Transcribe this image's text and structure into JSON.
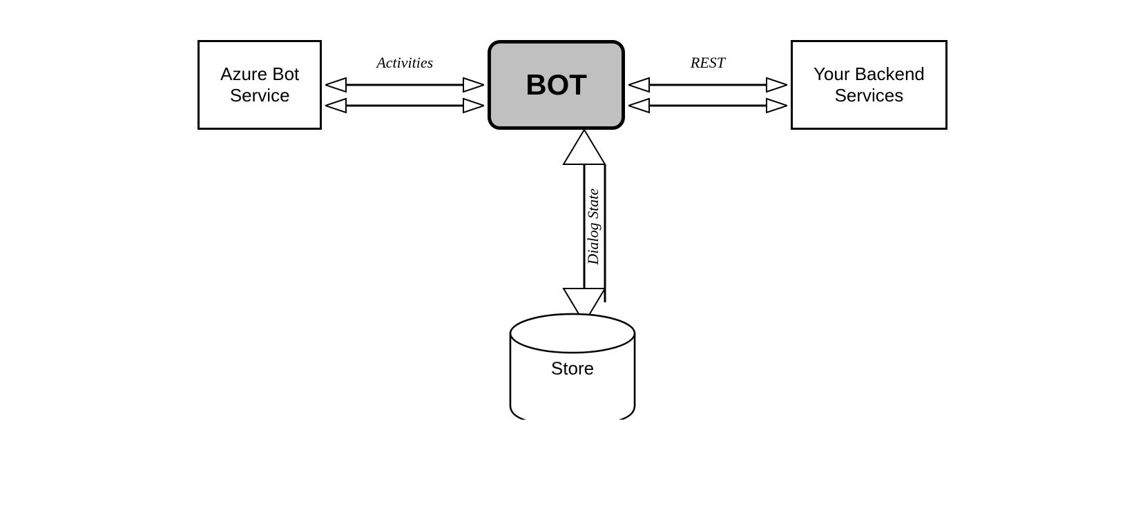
{
  "diagram": {
    "azure_box_label": "Azure Bot\nService",
    "bot_box_label": "BOT",
    "backend_box_label": "Your Backend\nServices",
    "activities_label": "Activities",
    "rest_label": "REST",
    "dialog_state_label": "Dialog State",
    "store_label": "Store"
  }
}
